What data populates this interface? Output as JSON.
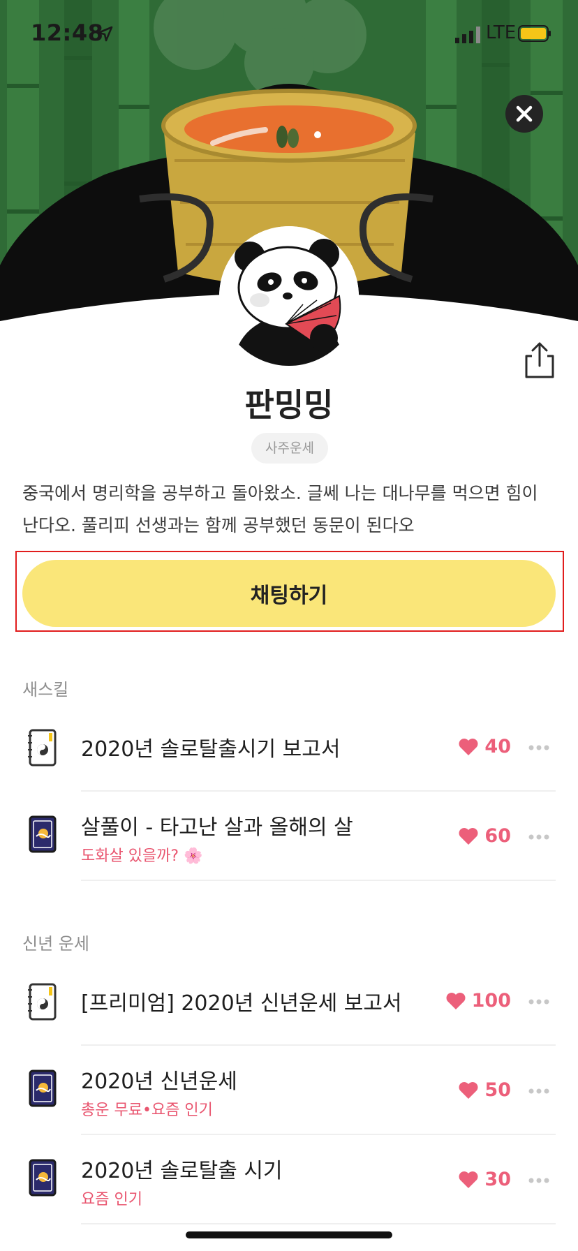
{
  "status_bar": {
    "time": "12:48",
    "network": "LTE"
  },
  "profile": {
    "name": "판밍밍",
    "tag": "사주운세",
    "description": "중국에서 명리학을 공부하고 돌아왔소. 글쎄 나는 대나무를 먹으면 힘이 난다오. 풀리피 선생과는 함께 공부했던 동문이 된다오"
  },
  "chat_button": {
    "label": "채팅하기"
  },
  "sections": [
    {
      "title": "새스킬",
      "items": [
        {
          "title": "2020년 솔로탈출시기 보고서",
          "subtitle": "",
          "likes": "40",
          "icon": "taegeuk-book-icon"
        },
        {
          "title": "살풀이 - 타고난 살과 올해의 살",
          "subtitle": "도화살 있을까? 🌸",
          "likes": "60",
          "icon": "fortune-card-icon"
        }
      ]
    },
    {
      "title": "신년 운세",
      "items": [
        {
          "title": "[프리미엄] 2020년 신년운세 보고서",
          "subtitle": "",
          "likes": "100",
          "icon": "taegeuk-book-icon"
        },
        {
          "title": "2020년 신년운세",
          "subtitle": "총운 무료•요즘 인기",
          "likes": "50",
          "icon": "fortune-card-icon"
        },
        {
          "title": "2020년 솔로탈출 시기",
          "subtitle": "요즘 인기",
          "likes": "30",
          "icon": "fortune-card-icon"
        }
      ]
    }
  ],
  "colors": {
    "accent_yellow": "#fae679",
    "like_pink": "#ec5f7a",
    "subtitle_pink": "#e9556f",
    "hero_green": "#2f6a35"
  }
}
